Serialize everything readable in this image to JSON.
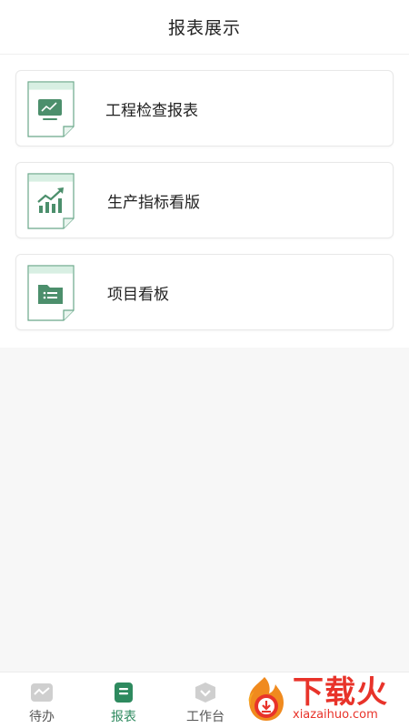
{
  "header": {
    "title": "报表展示"
  },
  "reports": [
    {
      "label": "工程检查报表",
      "icon": "monitor-chart-icon"
    },
    {
      "label": "生产指标看版",
      "icon": "growth-chart-icon"
    },
    {
      "label": "项目看板",
      "icon": "folder-list-icon"
    }
  ],
  "tabbar": {
    "tabs": [
      {
        "label": "待办",
        "icon": "pulse-icon",
        "active": false
      },
      {
        "label": "报表",
        "icon": "report-icon",
        "active": true
      },
      {
        "label": "工作台",
        "icon": "chevron-shield-icon",
        "active": false
      }
    ]
  },
  "watermark": {
    "main": "下载火",
    "sub": "xiazaihuo.com"
  },
  "colors": {
    "brand_green": "#2e8a5f",
    "icon_green": "#4c8f6c",
    "icon_bg": "#d8efe3",
    "watermark_red": "#e8332a"
  }
}
